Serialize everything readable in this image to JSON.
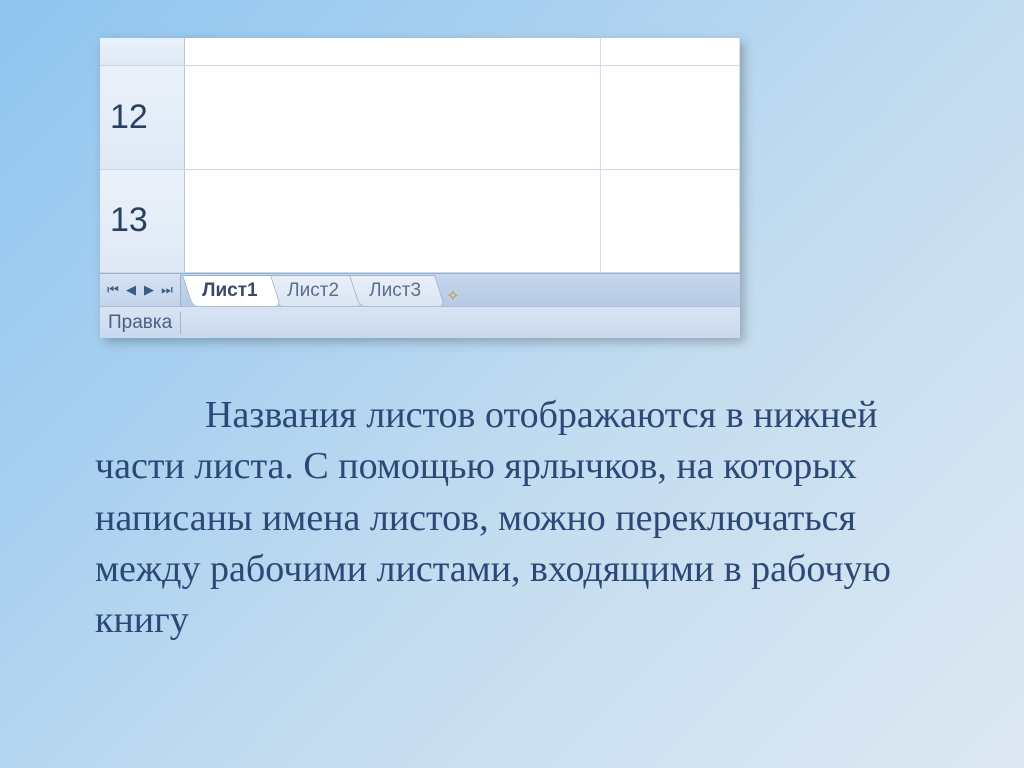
{
  "grid": {
    "rows": [
      "",
      "12",
      "13"
    ]
  },
  "nav": {
    "first": "⏮",
    "prev": "◀",
    "next": "▶",
    "last": "⏭"
  },
  "tabs": {
    "items": [
      {
        "label": "Лист1",
        "active": true
      },
      {
        "label": "Лист2",
        "active": false
      },
      {
        "label": "Лист3",
        "active": false
      }
    ],
    "new_icon": "✧"
  },
  "status": {
    "mode": "Правка"
  },
  "caption": "Названия листов отображаются в нижней части листа. С помощью ярлычков, на которых написаны имена листов, можно переключаться между рабочими листами, входящими в рабочую книгу"
}
